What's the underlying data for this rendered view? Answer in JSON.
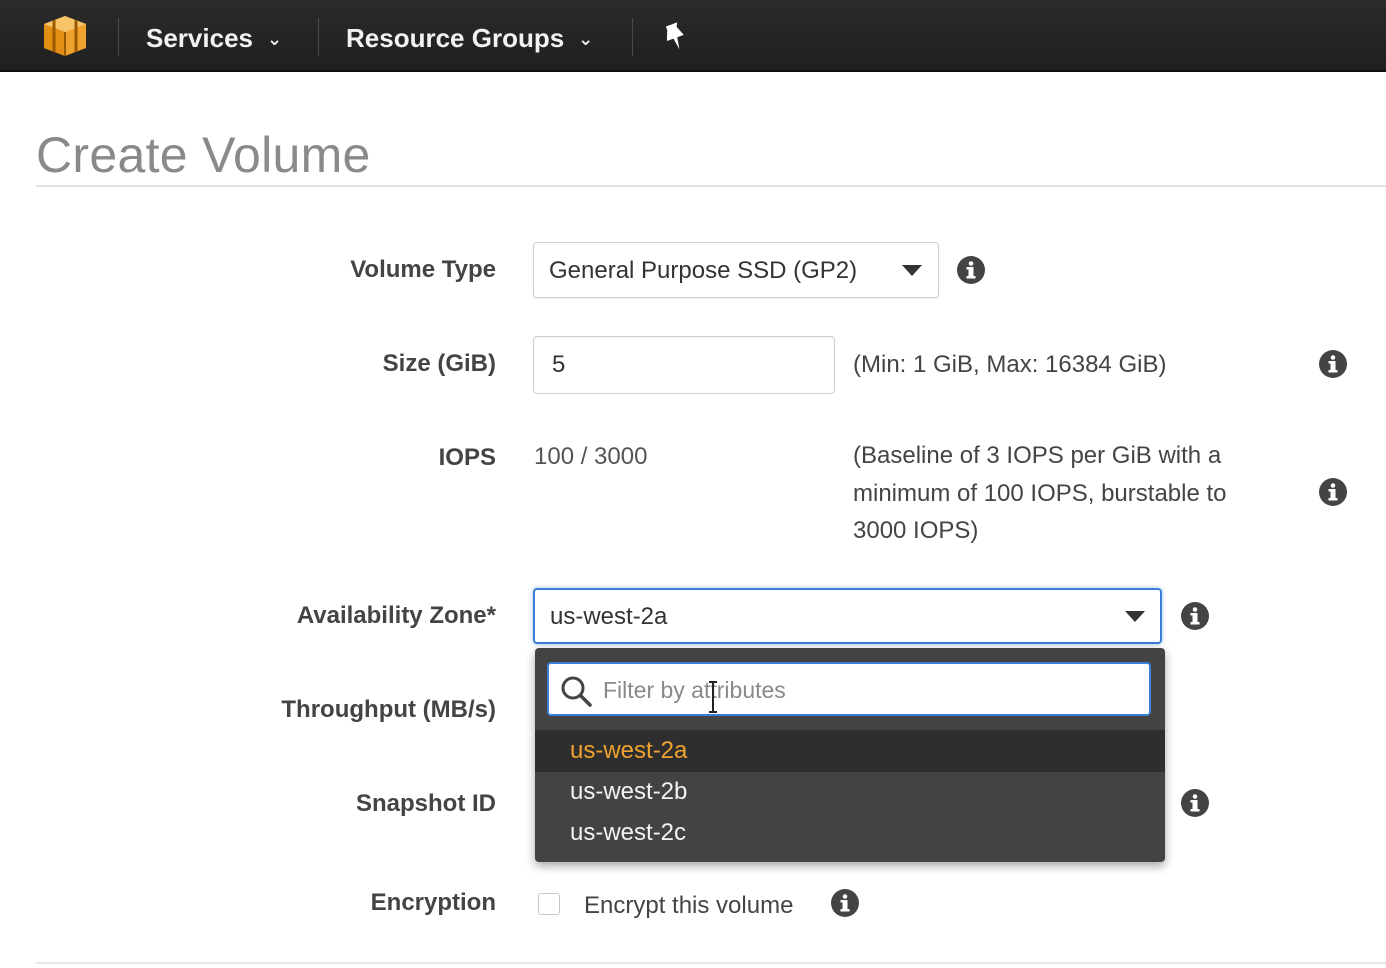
{
  "topnav": {
    "logo_icon": "aws-cube-icon",
    "services_label": "Services",
    "resource_groups_label": "Resource Groups",
    "pin_icon": "pushpin-icon"
  },
  "page": {
    "title": "Create Volume"
  },
  "form": {
    "volume_type": {
      "label": "Volume Type",
      "value": "General Purpose SSD (GP2)"
    },
    "size": {
      "label": "Size (GiB)",
      "value": "5",
      "hint": "(Min: 1 GiB, Max: 16384 GiB)"
    },
    "iops": {
      "label": "IOPS",
      "value": "100 / 3000",
      "hint_line1": "(Baseline of 3 IOPS per GiB with a",
      "hint_line2": "minimum of 100 IOPS, burstable to",
      "hint_line3": "3000 IOPS)"
    },
    "availability_zone": {
      "label": "Availability Zone*",
      "value": "us-west-2a"
    },
    "throughput": {
      "label": "Throughput (MB/s)"
    },
    "snapshot": {
      "label": "Snapshot ID"
    },
    "encryption": {
      "label": "Encryption",
      "checkbox_label": "Encrypt this volume",
      "checked": false
    }
  },
  "dropdown": {
    "filter_placeholder": "Filter by attributes",
    "options": [
      {
        "label": "us-west-2a",
        "selected": true
      },
      {
        "label": "us-west-2b",
        "selected": false
      },
      {
        "label": "us-west-2c",
        "selected": false
      }
    ]
  },
  "colors": {
    "nav_bg": "#232323",
    "accent_orange": "#f0a22e",
    "focus_blue": "#3a7fd5",
    "dropdown_bg": "#434343"
  }
}
